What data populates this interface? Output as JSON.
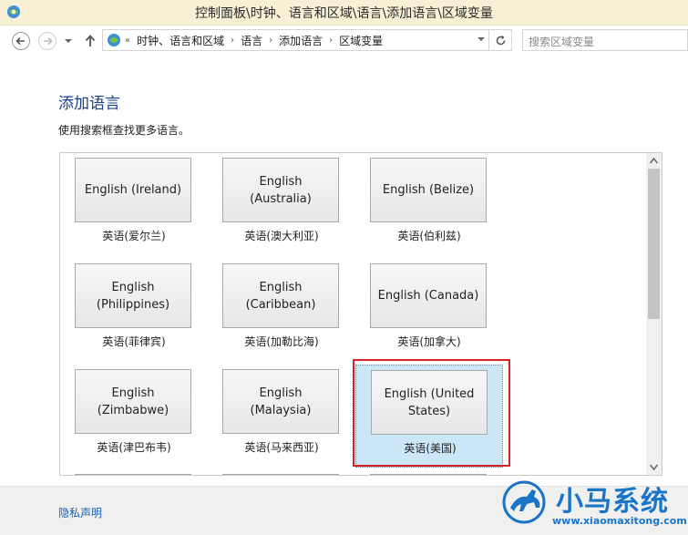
{
  "window": {
    "title": "控制面板\\时钟、语言和区域\\语言\\添加语言\\区域变量"
  },
  "navbar": {
    "breadcrumb_prefix": "«",
    "breadcrumbs": [
      "时钟、语言和区域",
      "语言",
      "添加语言",
      "区域变量"
    ],
    "breadcrumb_separator": "›",
    "search_placeholder": "搜索区域变量"
  },
  "page": {
    "title": "添加语言",
    "description": "使用搜索框查找更多语言。"
  },
  "languages": [
    {
      "name": "English (Ireland)",
      "caption": "英语(爱尔兰)",
      "selected": false
    },
    {
      "name": "English (Australia)",
      "caption": "英语(澳大利亚)",
      "selected": false
    },
    {
      "name": "English (Belize)",
      "caption": "英语(伯利兹)",
      "selected": false
    },
    {
      "name": "English (Philippines)",
      "caption": "英语(菲律宾)",
      "selected": false
    },
    {
      "name": "English (Caribbean)",
      "caption": "英语(加勒比海)",
      "selected": false
    },
    {
      "name": "English (Canada)",
      "caption": "英语(加拿大)",
      "selected": false
    },
    {
      "name": "English (Zimbabwe)",
      "caption": "英语(津巴布韦)",
      "selected": false
    },
    {
      "name": "English (Malaysia)",
      "caption": "英语(马来西亚)",
      "selected": false
    },
    {
      "name": "English (United States)",
      "caption": "英语(美国)",
      "selected": true
    }
  ],
  "footer": {
    "privacy_link": "隐私声明"
  },
  "watermark": {
    "brand": "小马系统",
    "url": "www.xiaomaxitong.com"
  },
  "colors": {
    "title_blue": "#1b3f8f",
    "link_blue": "#1b5fb0",
    "selection_bg": "#cbe6f6",
    "highlight_red": "#d8222a",
    "titlebar_bg": "#f7f0d4"
  }
}
